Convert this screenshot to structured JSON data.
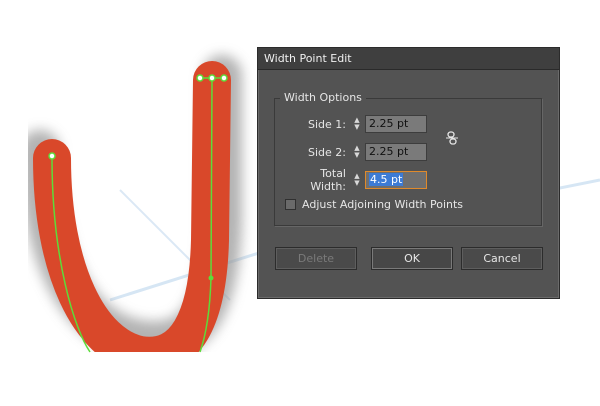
{
  "dialog": {
    "title": "Width Point Edit",
    "group_label": "Width Options",
    "side1": {
      "label": "Side 1:",
      "value": "2.25 pt"
    },
    "side2": {
      "label": "Side 2:",
      "value": "2.25 pt"
    },
    "total": {
      "label": "Total Width:",
      "value": "4.5 pt"
    },
    "adjust_label": "Adjust Adjoining Width Points",
    "adjust_checked": false,
    "buttons": {
      "delete": "Delete",
      "ok": "OK",
      "cancel": "Cancel"
    }
  },
  "colors": {
    "stroke": "#d9482a",
    "path": "#5ddc3a",
    "dialog_bg": "#535353",
    "focus": "#e08a2b",
    "selection": "#3d7bd5"
  },
  "icons": [
    "link-icon",
    "spinner-arrows-icon"
  ]
}
